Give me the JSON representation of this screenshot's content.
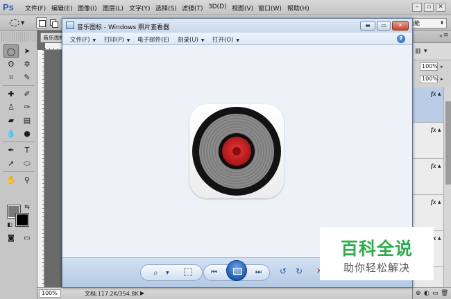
{
  "photoshop": {
    "logo": "Ps",
    "menu": [
      "文件(F)",
      "编辑(E)",
      "图像(I)",
      "图层(L)",
      "文字(Y)",
      "选择(S)",
      "滤镜(T)",
      "3D(D)",
      "视图(V)",
      "窗口(W)",
      "帮助(H)"
    ],
    "window_controls": {
      "minimize": "–",
      "restore": "▫",
      "close": "✕"
    },
    "options": {
      "workspace_label": "功能"
    },
    "document_tab": "音乐图标",
    "status": {
      "zoom": "100%",
      "doc_info": "文档:117.2K/354.8K",
      "arrow": "▶"
    },
    "layers_panel": {
      "close": "«",
      "opacity": "100%",
      "fill": "100%",
      "fx_label": "fx"
    },
    "colors": {
      "foreground": "#7a7a7a",
      "background": "#000000"
    }
  },
  "photo_viewer": {
    "title": "音乐图标 - Windows 照片查看器",
    "window_controls": {
      "minimize": "▬",
      "maximize": "▭",
      "close": "✕"
    },
    "menu": [
      {
        "label": "文件(F)"
      },
      {
        "label": "打印(P)"
      },
      {
        "label": "电子邮件(E)"
      },
      {
        "label": "刻录(U)"
      },
      {
        "label": "打开(O)"
      }
    ],
    "help": "?",
    "image": {
      "alt": "music-speaker-app-icon",
      "accent": "#c41c1c"
    },
    "controls": {
      "zoom": "⌕",
      "prev": "⏮",
      "next": "⏭",
      "rotate_ccw": "↺",
      "rotate_cw": "↻",
      "delete": "✕"
    }
  },
  "watermark": {
    "title": "百科全说",
    "subtitle": "助你轻松解决",
    "color": "#2aae4a"
  }
}
